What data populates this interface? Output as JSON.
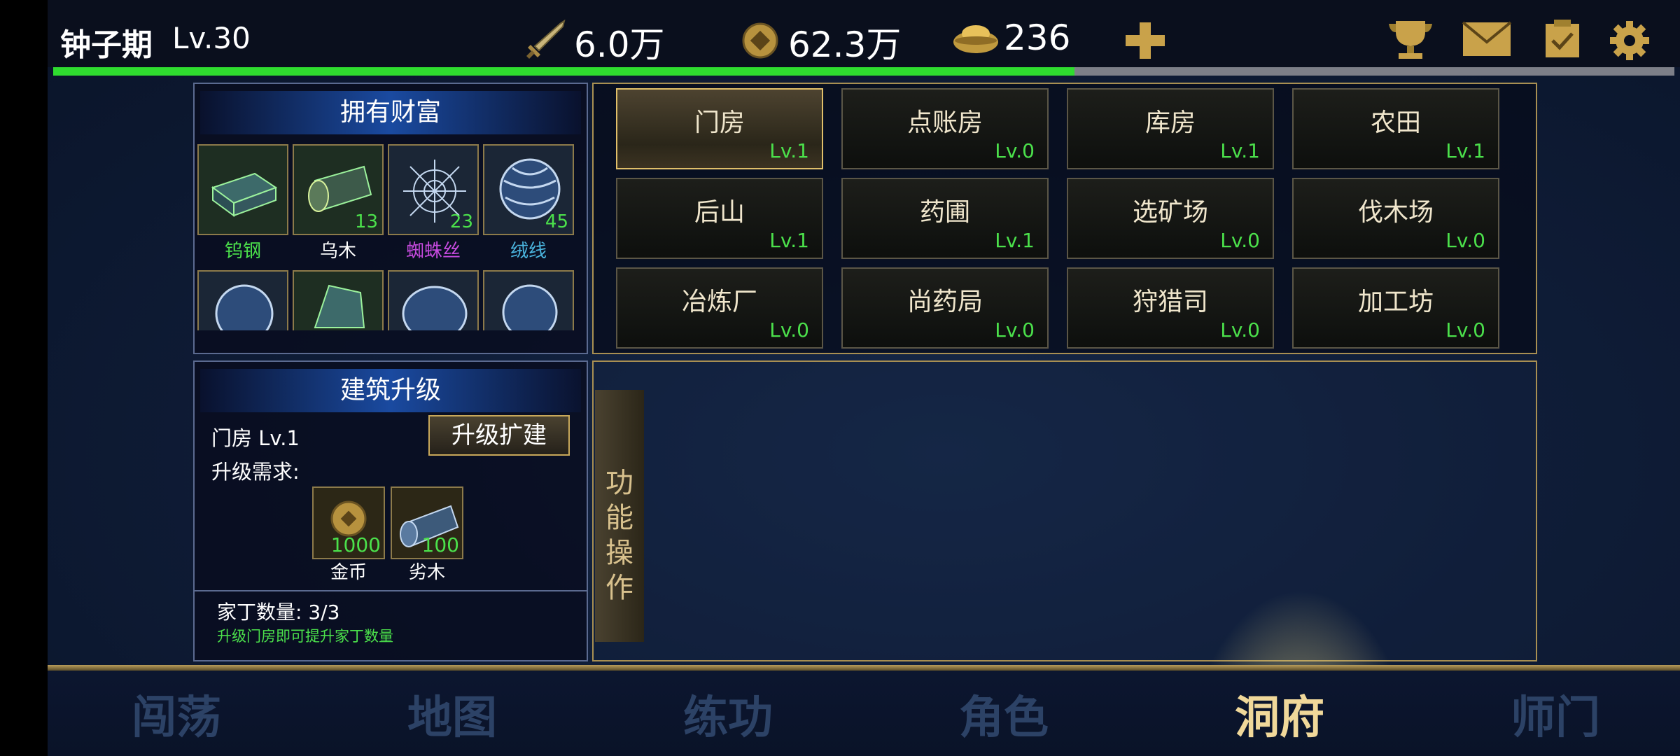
{
  "player": {
    "name": "钟子期",
    "level": "Lv.30",
    "exp_progress": 0.63
  },
  "stats": {
    "power": "6.0万",
    "coins": "62.3万",
    "ingots": "236"
  },
  "icons": {
    "power": "sword-icon",
    "coins": "coin-icon",
    "ingots": "gold-ingot-icon",
    "add": "plus-icon",
    "right": [
      "trophy-icon",
      "mail-icon",
      "clipboard-icon",
      "settings-gear-icon"
    ]
  },
  "wealth": {
    "title": "拥有财富",
    "items": [
      {
        "name": "钨钢",
        "count": "",
        "color": "#4be04b"
      },
      {
        "name": "乌木",
        "count": "13",
        "color": "#ffffff"
      },
      {
        "name": "蜘蛛丝",
        "count": "23",
        "color": "#c84be0"
      },
      {
        "name": "绒线",
        "count": "45",
        "color": "#4bb6e0"
      }
    ]
  },
  "buildings": [
    {
      "name": "门房",
      "level": "Lv.1",
      "selected": true
    },
    {
      "name": "点账房",
      "level": "Lv.0"
    },
    {
      "name": "库房",
      "level": "Lv.1"
    },
    {
      "name": "农田",
      "level": "Lv.1"
    },
    {
      "name": "后山",
      "level": "Lv.1"
    },
    {
      "name": "药圃",
      "level": "Lv.1"
    },
    {
      "name": "选矿场",
      "level": "Lv.0"
    },
    {
      "name": "伐木场",
      "level": "Lv.0"
    },
    {
      "name": "冶炼厂",
      "level": "Lv.0"
    },
    {
      "name": "尚药局",
      "level": "Lv.0"
    },
    {
      "name": "狩猎司",
      "level": "Lv.0"
    },
    {
      "name": "加工坊",
      "level": "Lv.0"
    }
  ],
  "upgrade": {
    "title": "建筑升级",
    "current": "门房 Lv.1",
    "button": "升级扩建",
    "requirement_label": "升级需求:",
    "requirements": [
      {
        "name": "金币",
        "amount": "1000"
      },
      {
        "name": "劣木",
        "amount": "100"
      }
    ],
    "staff": "家丁数量: 3/3",
    "hint": "升级门房即可提升家丁数量"
  },
  "function_tab": [
    "功",
    "能",
    "操",
    "作"
  ],
  "nav": [
    {
      "label": "闯荡"
    },
    {
      "label": "地图"
    },
    {
      "label": "练功"
    },
    {
      "label": "角色"
    },
    {
      "label": "洞府",
      "active": true
    },
    {
      "label": "师门"
    }
  ]
}
